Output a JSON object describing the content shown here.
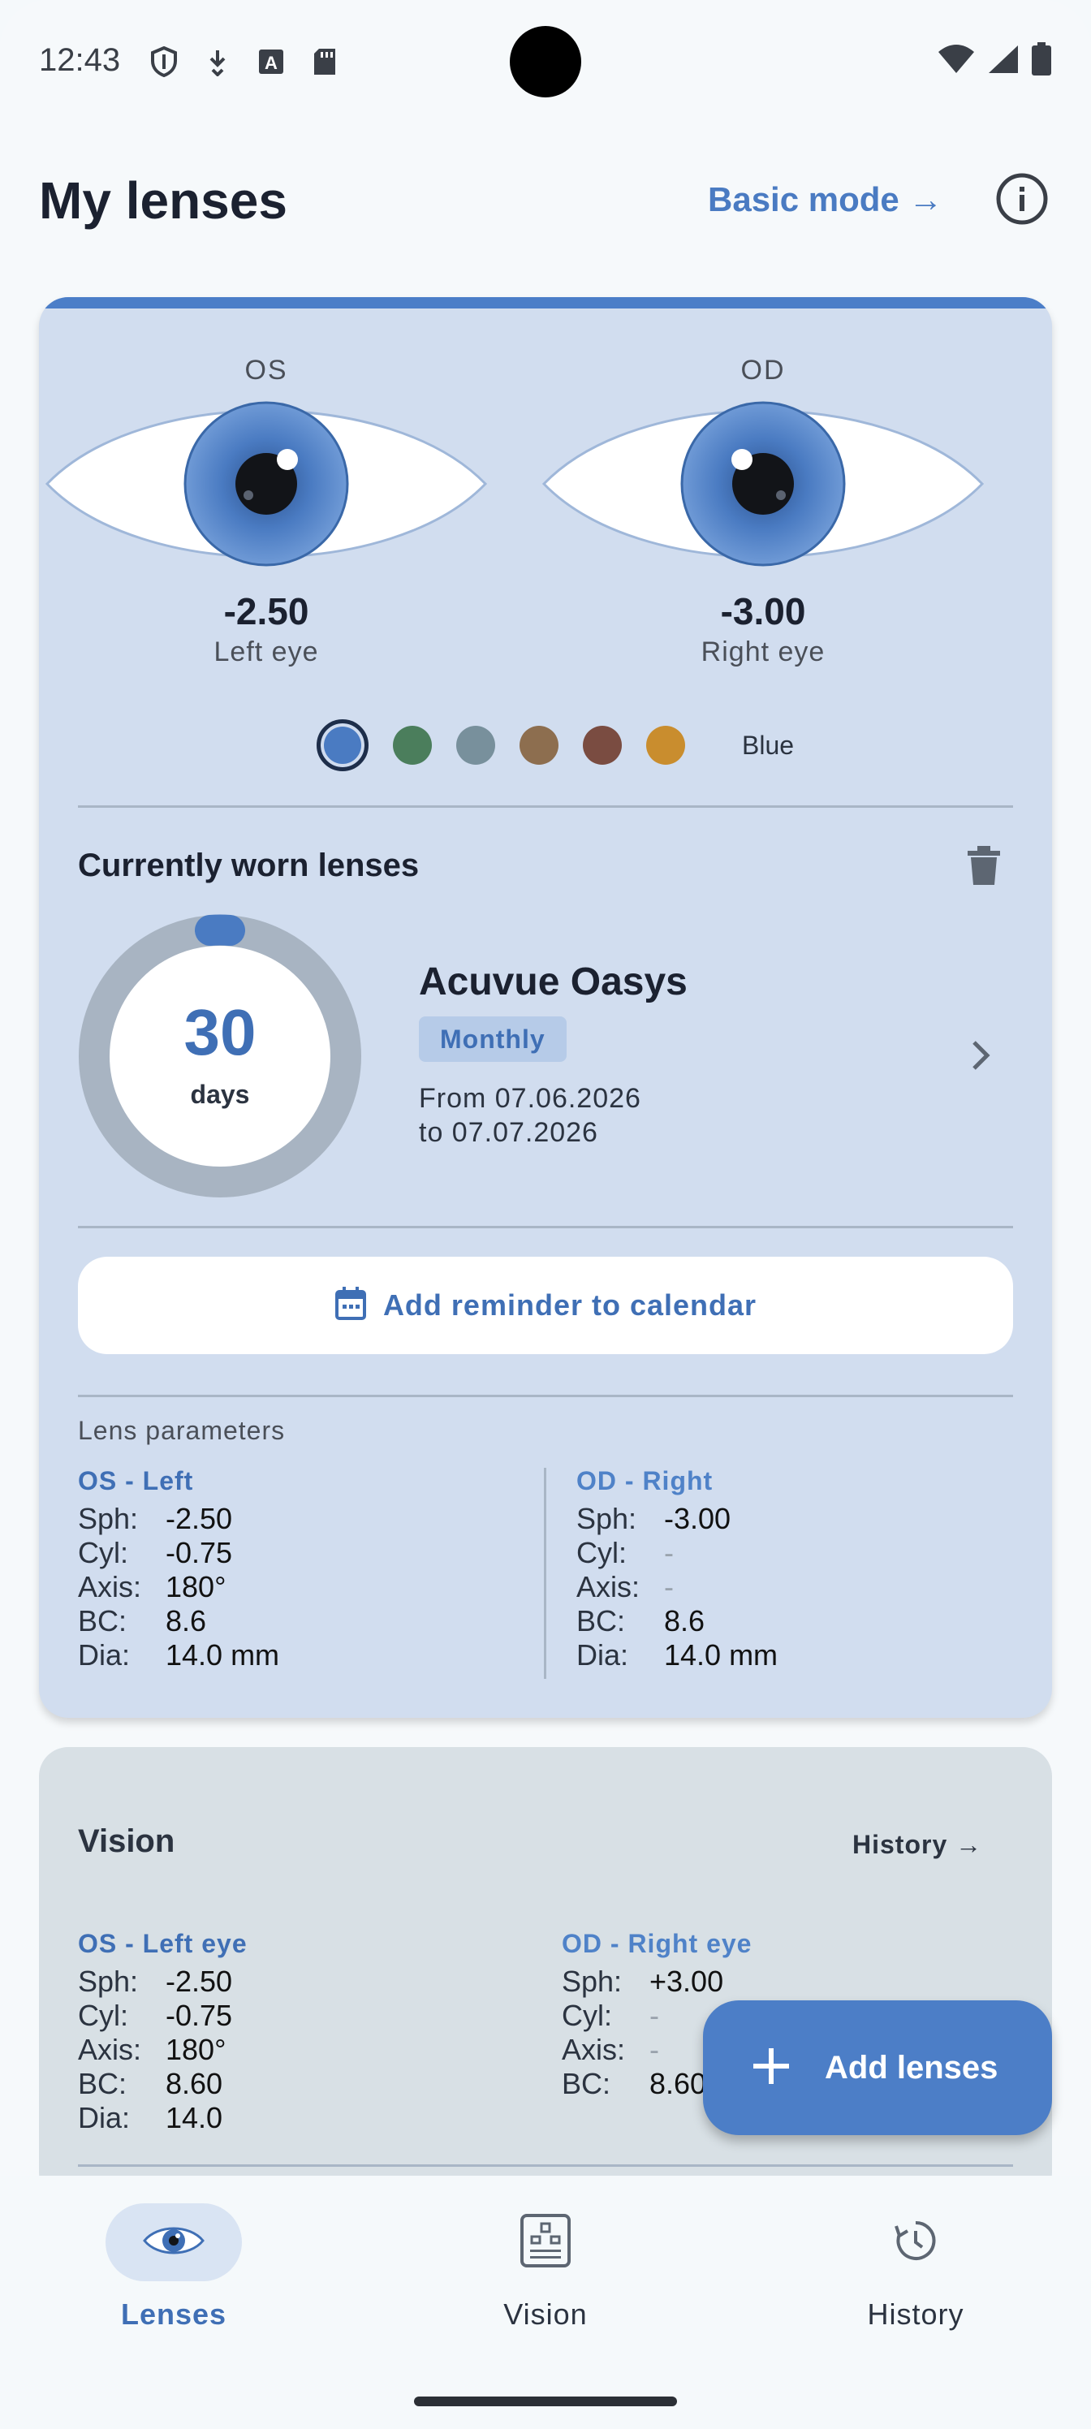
{
  "status_bar": {
    "time": "12:43",
    "left_icons": [
      "shield-icon",
      "download-icon",
      "font-a-icon",
      "sd-card-icon"
    ],
    "right_icons": [
      "wifi-icon",
      "signal-icon",
      "battery-icon"
    ]
  },
  "header": {
    "title": "My lenses",
    "mode_link": "Basic mode →",
    "info_icon": "info-icon"
  },
  "eyes": {
    "left": {
      "code": "OS",
      "power": "-2.50",
      "name": "Left eye"
    },
    "right": {
      "code": "OD",
      "power": "-3.00",
      "name": "Right eye"
    },
    "iris_colors": [
      "#4a7bc2",
      "#4b7e5c",
      "#78909c",
      "#8d6e4f",
      "#7a4c41",
      "#c98d2e"
    ],
    "selected_color_name": "Blue"
  },
  "current_lenses": {
    "title": "Currently worn lenses",
    "days": "30",
    "days_unit": "days",
    "brand": "Acuvue Oasys",
    "type": "Monthly",
    "from": "From 07.06.2026",
    "to": "to 07.07.2026",
    "reminder_label": "Add reminder to calendar"
  },
  "lens_params": {
    "title": "Lens parameters",
    "left": {
      "heading": "OS - Left",
      "rows": [
        {
          "k": "Sph:",
          "v": "-2.50"
        },
        {
          "k": "Cyl:",
          "v": "-0.75"
        },
        {
          "k": "Axis:",
          "v": "180°"
        },
        {
          "k": "BC:",
          "v": "8.6"
        },
        {
          "k": "Dia:",
          "v": "14.0 mm"
        }
      ]
    },
    "right": {
      "heading": "OD - Right",
      "rows": [
        {
          "k": "Sph:",
          "v": "-3.00"
        },
        {
          "k": "Cyl:",
          "v": "-"
        },
        {
          "k": "Axis:",
          "v": "-"
        },
        {
          "k": "BC:",
          "v": "8.6"
        },
        {
          "k": "Dia:",
          "v": "14.0 mm"
        }
      ]
    }
  },
  "vision": {
    "title": "Vision",
    "history_link": "History →",
    "left": {
      "heading": "OS - Left eye",
      "rows": [
        {
          "k": "Sph:",
          "v": "-2.50"
        },
        {
          "k": "Cyl:",
          "v": "-0.75"
        },
        {
          "k": "Axis:",
          "v": "180°"
        },
        {
          "k": "BC:",
          "v": "8.60"
        },
        {
          "k": "Dia:",
          "v": "14.0"
        }
      ]
    },
    "right": {
      "heading": "OD - Right eye",
      "rows": [
        {
          "k": "Sph:",
          "v": "+3.00"
        },
        {
          "k": "Cyl:",
          "v": "-"
        },
        {
          "k": "Axis:",
          "v": "-"
        },
        {
          "k": "BC:",
          "v": "8.60"
        }
      ]
    }
  },
  "fab": {
    "label": "Add lenses"
  },
  "bottom_nav": {
    "lenses": "Lenses",
    "vision": "Vision",
    "history": "History"
  },
  "colors": {
    "accent": "#4a7bc2",
    "card_bg": "#d1ddef",
    "vision_card_bg": "#d8e0e5"
  }
}
